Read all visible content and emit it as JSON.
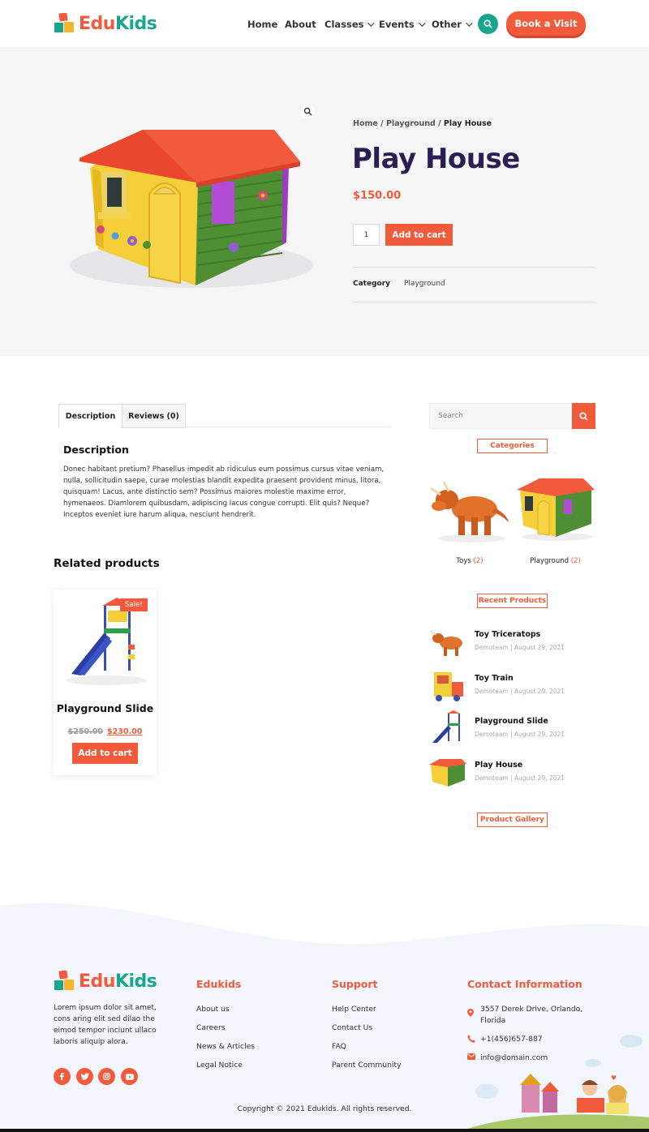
{
  "header": {
    "logo": {
      "part1": "Edu",
      "part2": "Kids"
    },
    "nav": [
      {
        "label": "Home",
        "has_dropdown": false
      },
      {
        "label": "About",
        "has_dropdown": false
      },
      {
        "label": "Classes",
        "has_dropdown": true
      },
      {
        "label": "Events",
        "has_dropdown": true
      },
      {
        "label": "Other",
        "has_dropdown": true
      }
    ],
    "search_icon": "search-icon",
    "cta_label": "Book a Visit"
  },
  "product": {
    "breadcrumb": {
      "home": "Home",
      "sep": "/",
      "category": "Playground",
      "current": "Play House"
    },
    "title": "Play House",
    "price": "$150.00",
    "quantity": "1",
    "add_to_cart": "Add to cart",
    "category_label": "Category",
    "category_value": "Playground",
    "zoom_icon": "magnifier-icon"
  },
  "tabs": [
    {
      "label": "Description",
      "active": true
    },
    {
      "label": "Reviews (0)",
      "active": false
    }
  ],
  "description": {
    "heading": "Description",
    "text": "Donec habitant pretium? Phasellus impedit ab ridiculus eum possimus cursus vitae veniam, nulla, sollicitudin saepe, curae molestias blandit expedita praesent provident minus, litora, quisquam! Lacus, ante distinctio sem? Possimus maiores molestie maxime error, hymenaeos. Diamlorem quibusdam, adipiscing lacus congue corrupti. Elit quis? Neque? Inceptos eveniet iure harum aliqua, nesciunt hendrerit."
  },
  "related": {
    "heading": "Related products",
    "items": [
      {
        "sale_badge": "Sale!",
        "title": "Playground Slide",
        "old_price": "$250.00",
        "new_price": "$230.00",
        "button": "Add to cart"
      }
    ]
  },
  "sidebar": {
    "search_placeholder": "Search",
    "categories_title": "Categories",
    "categories": [
      {
        "name": "Toys",
        "count": "(2)"
      },
      {
        "name": "Playground",
        "count": "(2)"
      }
    ],
    "recent_title": "Recent Products",
    "recent": [
      {
        "title": "Toy Triceratops",
        "meta": "Demoteam | August 29, 2021"
      },
      {
        "title": "Toy Train",
        "meta": "Demoteam | August 29, 2021"
      },
      {
        "title": "Playground Slide",
        "meta": "Demoteam | August 29, 2021"
      },
      {
        "title": "Play House",
        "meta": "Demoteam | August 29, 2021"
      }
    ],
    "gallery_title": "Product Gallery"
  },
  "footer": {
    "about": "Lorem ipsum dolor sit amet, cons aring elit sed dilao the eimod tempor inciunt ullaco laboris aliquip alora.",
    "social": [
      "facebook-icon",
      "twitter-icon",
      "instagram-icon",
      "youtube-icon"
    ],
    "col1": {
      "heading": "Edukids",
      "links": [
        "About us",
        "Careers",
        "News & Articles",
        "Legal Notice"
      ]
    },
    "col2": {
      "heading": "Support",
      "links": [
        "Help Center",
        "Contact Us",
        "FAQ",
        "Parent Community"
      ]
    },
    "contact": {
      "heading": "Contact Information",
      "address": "3557 Derek Drive, Orlando, Florida",
      "phone": "+1(456)657-887",
      "email": "info@domain.com"
    },
    "copyright": "Copyright © 2021 Edukids. All rights reserved."
  },
  "colors": {
    "accent": "#f25a3c",
    "teal": "#1aa68e",
    "title": "#2a1e55"
  }
}
